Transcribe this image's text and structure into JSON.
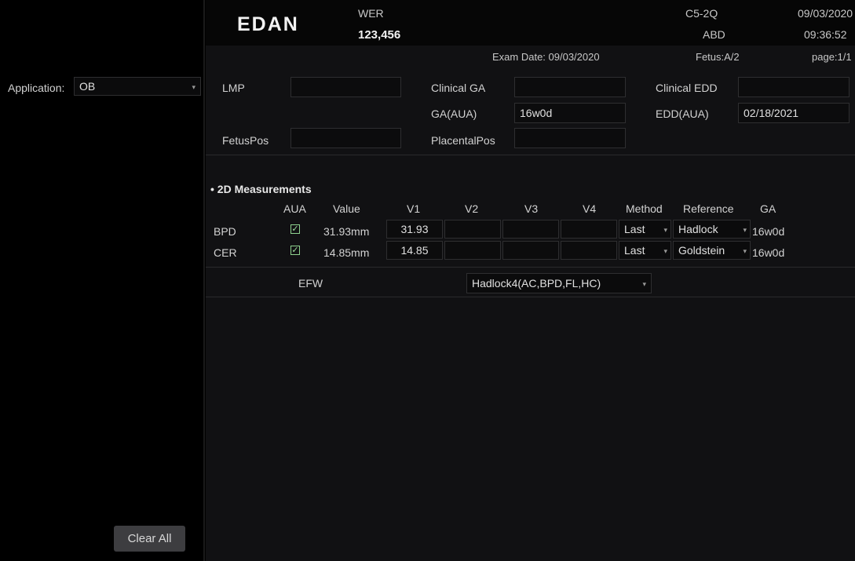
{
  "header": {
    "logo": "EDAN",
    "patient_name": "WER",
    "patient_id": "123,456",
    "probe": "C5-2Q",
    "exam_type": "ABD",
    "date": "09/03/2020",
    "time": "09:36:52"
  },
  "subheader": {
    "exam_date": "Exam Date: 09/03/2020",
    "fetus": "Fetus:A/2",
    "page": "page:1/1"
  },
  "sidebar": {
    "application_label": "Application:",
    "application_value": "OB",
    "clear_all": "Clear All"
  },
  "form": {
    "lmp_label": "LMP",
    "lmp_value": "",
    "clinical_ga_label": "Clinical GA",
    "clinical_ga_value": "",
    "clinical_edd_label": "Clinical EDD",
    "clinical_edd_value": "",
    "ga_aua_label": "GA(AUA)",
    "ga_aua_value": "16w0d",
    "edd_aua_label": "EDD(AUA)",
    "edd_aua_value": "02/18/2021",
    "fetuspos_label": "FetusPos",
    "fetuspos_value": "",
    "placentalpos_label": "PlacentalPos",
    "placentalpos_value": ""
  },
  "measurements": {
    "section_title": "• 2D Measurements",
    "columns": [
      "AUA",
      "Value",
      "V1",
      "V2",
      "V3",
      "V4",
      "Method",
      "Reference",
      "GA"
    ],
    "rows": [
      {
        "name": "BPD",
        "aua": true,
        "value": "31.93mm",
        "v1": "31.93",
        "v2": "",
        "v3": "",
        "v4": "",
        "method": "Last",
        "reference": "Hadlock",
        "ga": "16w0d"
      },
      {
        "name": "CER",
        "aua": true,
        "value": "14.85mm",
        "v1": "14.85",
        "v2": "",
        "v3": "",
        "v4": "",
        "method": "Last",
        "reference": "Goldstein",
        "ga": "16w0d"
      }
    ]
  },
  "efw": {
    "label": "EFW",
    "formula": "Hadlock4(AC,BPD,FL,HC)"
  },
  "icons": {
    "dropdown": "chevron-down-icon",
    "check": "checkmark-icon"
  }
}
